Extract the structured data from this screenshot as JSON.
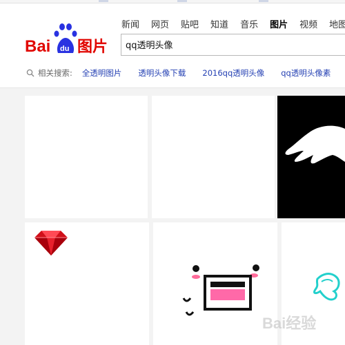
{
  "nav": {
    "items": [
      {
        "label": "新闻",
        "active": false
      },
      {
        "label": "网页",
        "active": false
      },
      {
        "label": "贴吧",
        "active": false
      },
      {
        "label": "知道",
        "active": false
      },
      {
        "label": "音乐",
        "active": false
      },
      {
        "label": "图片",
        "active": true
      },
      {
        "label": "视频",
        "active": false
      },
      {
        "label": "地图",
        "active": false
      }
    ]
  },
  "logo": {
    "brand_left": "Bai",
    "brand_paw": "du",
    "brand_right": "图片",
    "color_red": "#e10601",
    "color_blue": "#2932e1"
  },
  "search": {
    "value": "qq透明头像"
  },
  "related": {
    "label": "相关搜索:",
    "links": [
      "全透明图片",
      "透明头像下载",
      "2016qq透明头像",
      "qq透明头像素"
    ]
  },
  "tiles": [
    {
      "name": "blank-image-1",
      "content": "white"
    },
    {
      "name": "blank-image-2",
      "content": "white"
    },
    {
      "name": "angel-wing-image",
      "content": "white wing on black"
    },
    {
      "name": "red-diamond-image",
      "content": "red diamond"
    },
    {
      "name": "cute-face-image",
      "content": "cartoon face"
    },
    {
      "name": "cyan-wing-image",
      "content": "cyan wing sketch"
    }
  ],
  "watermark": {
    "text": "Bai经验"
  }
}
